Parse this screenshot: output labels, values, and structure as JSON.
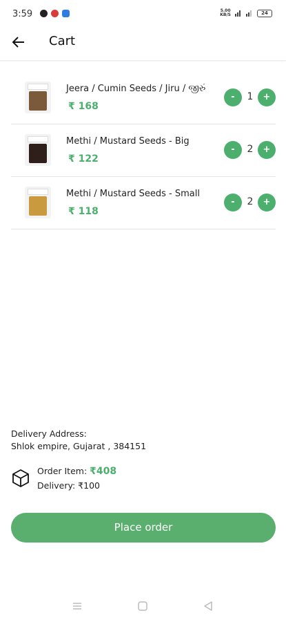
{
  "status_bar": {
    "time": "3:59",
    "net_speed_value": "5.00",
    "net_speed_unit": "KB/S",
    "battery": "24"
  },
  "header": {
    "title": "Cart"
  },
  "cart": {
    "items": [
      {
        "name": "Jeera / Cumin Seeds / Jiru / જીરું",
        "price": "₹ 168",
        "quantity": "1",
        "minus": "-",
        "plus": "+"
      },
      {
        "name": "Methi / Mustard Seeds - Big",
        "price": "₹ 122",
        "quantity": "2",
        "minus": "-",
        "plus": "+"
      },
      {
        "name": "Methi / Mustard Seeds - Small",
        "price": "₹ 118",
        "quantity": "2",
        "minus": "-",
        "plus": "+"
      }
    ]
  },
  "delivery": {
    "label": "Delivery Address:",
    "address": "Shlok empire, Gujarat , 384151"
  },
  "order_summary": {
    "order_item_label": "Order Item: ",
    "order_item_amount": "₹408",
    "delivery_label": "Delivery: ₹100"
  },
  "actions": {
    "place_order_label": "Place order"
  },
  "colors": {
    "accent": "#4caf6e",
    "button": "#5aaf6f"
  },
  "icons": {
    "back": "arrow-left-icon",
    "order": "box-icon",
    "nav_menu": "menu-icon",
    "nav_home": "home-icon",
    "nav_back": "triangle-back-icon"
  }
}
